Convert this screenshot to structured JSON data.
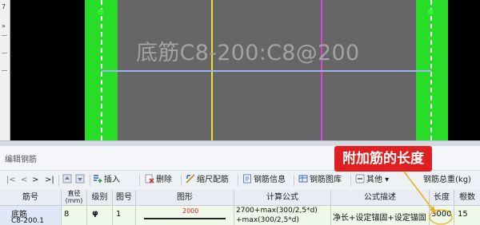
{
  "drawing": {
    "rebar_label": "底筋C8-200:C8@200",
    "side_ticks": [
      "7",
      "»"
    ]
  },
  "panel": {
    "title": "编辑钢筋"
  },
  "toolbar": {
    "nav": [
      "|<",
      "<",
      ">",
      ">|"
    ],
    "buttons": [
      {
        "label": "插入",
        "icon": "insert-row-icon"
      },
      {
        "label": "删除",
        "icon": "delete-row-icon"
      },
      {
        "label": "缩尺配筋",
        "icon": "scale-rebar-icon"
      },
      {
        "label": "钢筋信息",
        "icon": "rebar-info-icon"
      },
      {
        "label": "钢筋图库",
        "icon": "rebar-library-icon"
      },
      {
        "label": "其他 ▾",
        "icon": "other-icon"
      }
    ],
    "total_weight_label": "钢筋总重(kg)"
  },
  "table": {
    "headers": [
      "筋号",
      "直径(mm)",
      "级别",
      "图号",
      "图形",
      "计算公式",
      "公式描述",
      "长度",
      "根数"
    ],
    "row": {
      "name": "底筋",
      "name_sub": "C8-200.1",
      "diameter": "8",
      "grade": "φ",
      "shape_no": "1",
      "shape_value": "2000",
      "formula_line1": "2700+max(300/2,5*d)",
      "formula_line2": "+max(300/2,5*d)",
      "formula_desc": "净长+设定锚固+设定锚固",
      "length": "3000",
      "count": "15"
    }
  },
  "annotation": {
    "text": "附加筋的长度"
  },
  "colors": {
    "green_bar": "#27dd27",
    "gray_beam": "#666666",
    "yellow_line": "#f0e130",
    "magenta_line": "#e040e0",
    "blue_line": "#9bb3ee",
    "annotation_red": "#e02020",
    "table_row_bg": "#eef9ea"
  }
}
